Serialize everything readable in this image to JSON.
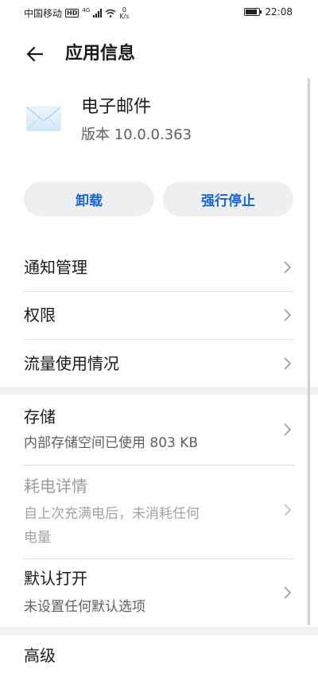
{
  "status_bar": {
    "carrier": "中国移动",
    "hd": "HD",
    "network": "4G",
    "speed_value": "0",
    "speed_unit": "K/s",
    "time": "22:08",
    "battery_level": 0.85
  },
  "header": {
    "title": "应用信息"
  },
  "app": {
    "name": "电子邮件",
    "version": "版本 10.0.0.363"
  },
  "actions": {
    "uninstall": "卸载",
    "force_stop": "强行停止"
  },
  "rows": {
    "notifications": {
      "title": "通知管理"
    },
    "permissions": {
      "title": "权限"
    },
    "data_usage": {
      "title": "流量使用情况"
    },
    "storage": {
      "title": "存储",
      "subtitle": "内部存储空间已使用 803 KB"
    },
    "battery": {
      "title": "耗电详情",
      "subtitle_line1": "自上次充满电后，未消耗任何",
      "subtitle_line2": "电量"
    },
    "open_by_default": {
      "title": "默认打开",
      "subtitle": "未设置任何默认选项"
    },
    "advanced": {
      "title": "高级"
    }
  },
  "colors": {
    "accent": "#1766d6",
    "button_bg": "#eeeff1",
    "divider": "#e3e3e3"
  }
}
